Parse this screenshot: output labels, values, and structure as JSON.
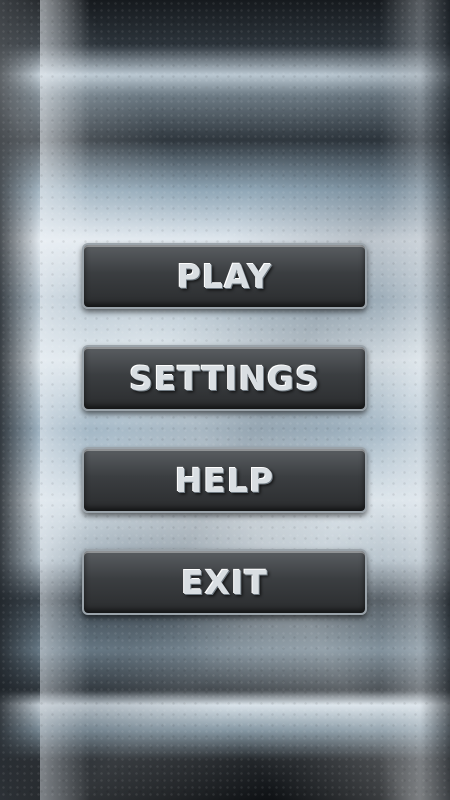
{
  "menu": {
    "items": [
      {
        "id": "play",
        "label": "PLAY"
      },
      {
        "id": "settings",
        "label": "SETTINGS"
      },
      {
        "id": "help",
        "label": "HELP"
      },
      {
        "id": "exit",
        "label": "EXIT"
      }
    ]
  },
  "colors": {
    "button_face": "#3b3e41",
    "button_border": "#9aa3aa",
    "button_text": "#d9dee2",
    "background_highlight": "#dfe7ee",
    "background_dark": "#161a1e"
  }
}
